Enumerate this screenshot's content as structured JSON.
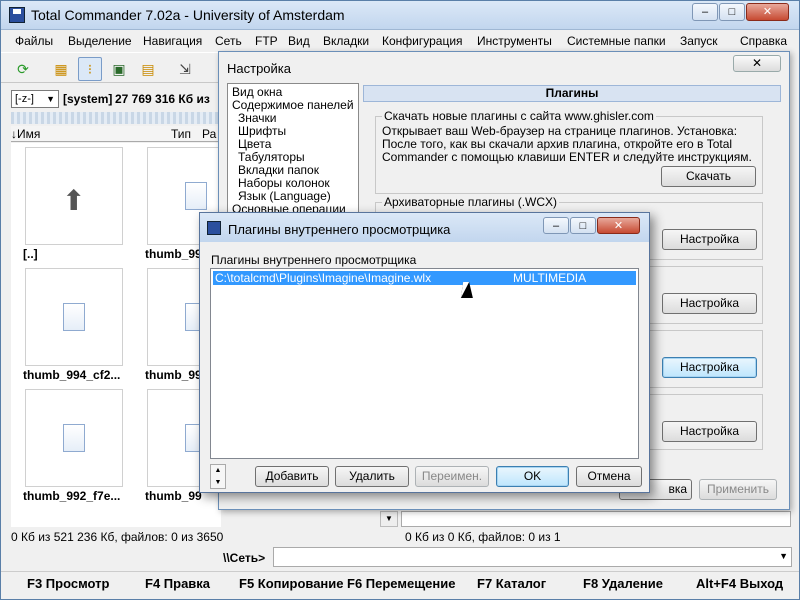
{
  "window": {
    "title": "Total Commander 7.02a - University of Amsterdam",
    "app_icon": "floppy-disk-icon",
    "minimize": "–",
    "maximize": "□",
    "close": "✕"
  },
  "menu": [
    "Файлы",
    "Выделение",
    "Навигация",
    "Сеть",
    "FTP",
    "Вид",
    "Вкладки",
    "Конфигурация",
    "Инструменты",
    "Системные папки",
    "Запуск",
    "Справка"
  ],
  "toolbar": {
    "icons": [
      "refresh-icon",
      "brief-view-icon",
      "thumbnail-view-icon",
      "tree-view-icon",
      "extended-view-icon",
      "unpack-icon"
    ]
  },
  "left_panel": {
    "drive": "[-z-]",
    "drive_label": "[system]",
    "drive_info": "27 769 316 Кб из",
    "col_name": "↓Имя",
    "col_type": "Тип",
    "col_size": "Ра",
    "thumbs": [
      {
        "label": "[..]",
        "kind": "up-arrow-icon"
      },
      {
        "label": "thumb_99",
        "kind": "file-icon"
      },
      {
        "label": "thumb_994_cf2...",
        "kind": "file-icon"
      },
      {
        "label": "thumb_99",
        "kind": "file-icon"
      },
      {
        "label": "thumb_992_f7e...",
        "kind": "file-icon"
      },
      {
        "label": "thumb_99",
        "kind": "file-icon"
      }
    ],
    "status": "0 Кб из 521 236 Кб, файлов: 0 из 3650"
  },
  "right_panel": {
    "status": "0 Кб из 0 Кб, файлов: 0 из 1"
  },
  "command_line": {
    "label": "\\\\Сеть>",
    "value": ""
  },
  "fkeys": [
    "F3 Просмотр",
    "F4 Правка",
    "F5 Копирование",
    "F6 Перемещение",
    "F7 Каталог",
    "F8 Удаление",
    "Alt+F4 Выход"
  ],
  "settings": {
    "title": "Настройка",
    "close": "✕",
    "tree": [
      "Вид окна",
      "Содержимое панелей",
      "Значки",
      "Шрифты",
      "Цвета",
      "Табуляторы",
      "Вкладки папок",
      "Наборы колонок",
      "Язык (Language)",
      "Основные операции"
    ],
    "heading": "Плагины",
    "download_group": "Скачать новые плагины с сайта www.ghisler.com",
    "download_text": "Открывает ваш Web-браузер на странице плагинов. Установка: После того, как вы скачали архив плагина, откройте его в Total Commander с помощью клавиши ENTER и следуйте инструкциям.",
    "download_button": "Скачать",
    "archive_group": "Архиваторные плагины (.WCX)",
    "config_button": "Настройка",
    "ok_partial": "вка",
    "apply": "Применить"
  },
  "viewer_dialog": {
    "title": "Плагины внутреннего просмотрщика",
    "list_label": "Плагины внутреннего просмотрщика",
    "rows": [
      {
        "path": "C:\\totalcmd\\Plugins\\Imagine\\Imagine.wlx",
        "type": "MULTIMEDIA"
      }
    ],
    "add": "Добавить",
    "remove": "Удалить",
    "rename": "Переимен.",
    "ok": "OK",
    "cancel": "Отмена"
  },
  "colors": {
    "selection": "#3399ff",
    "title_bar": "#c2d6ee",
    "close_button": "#c74a32"
  }
}
